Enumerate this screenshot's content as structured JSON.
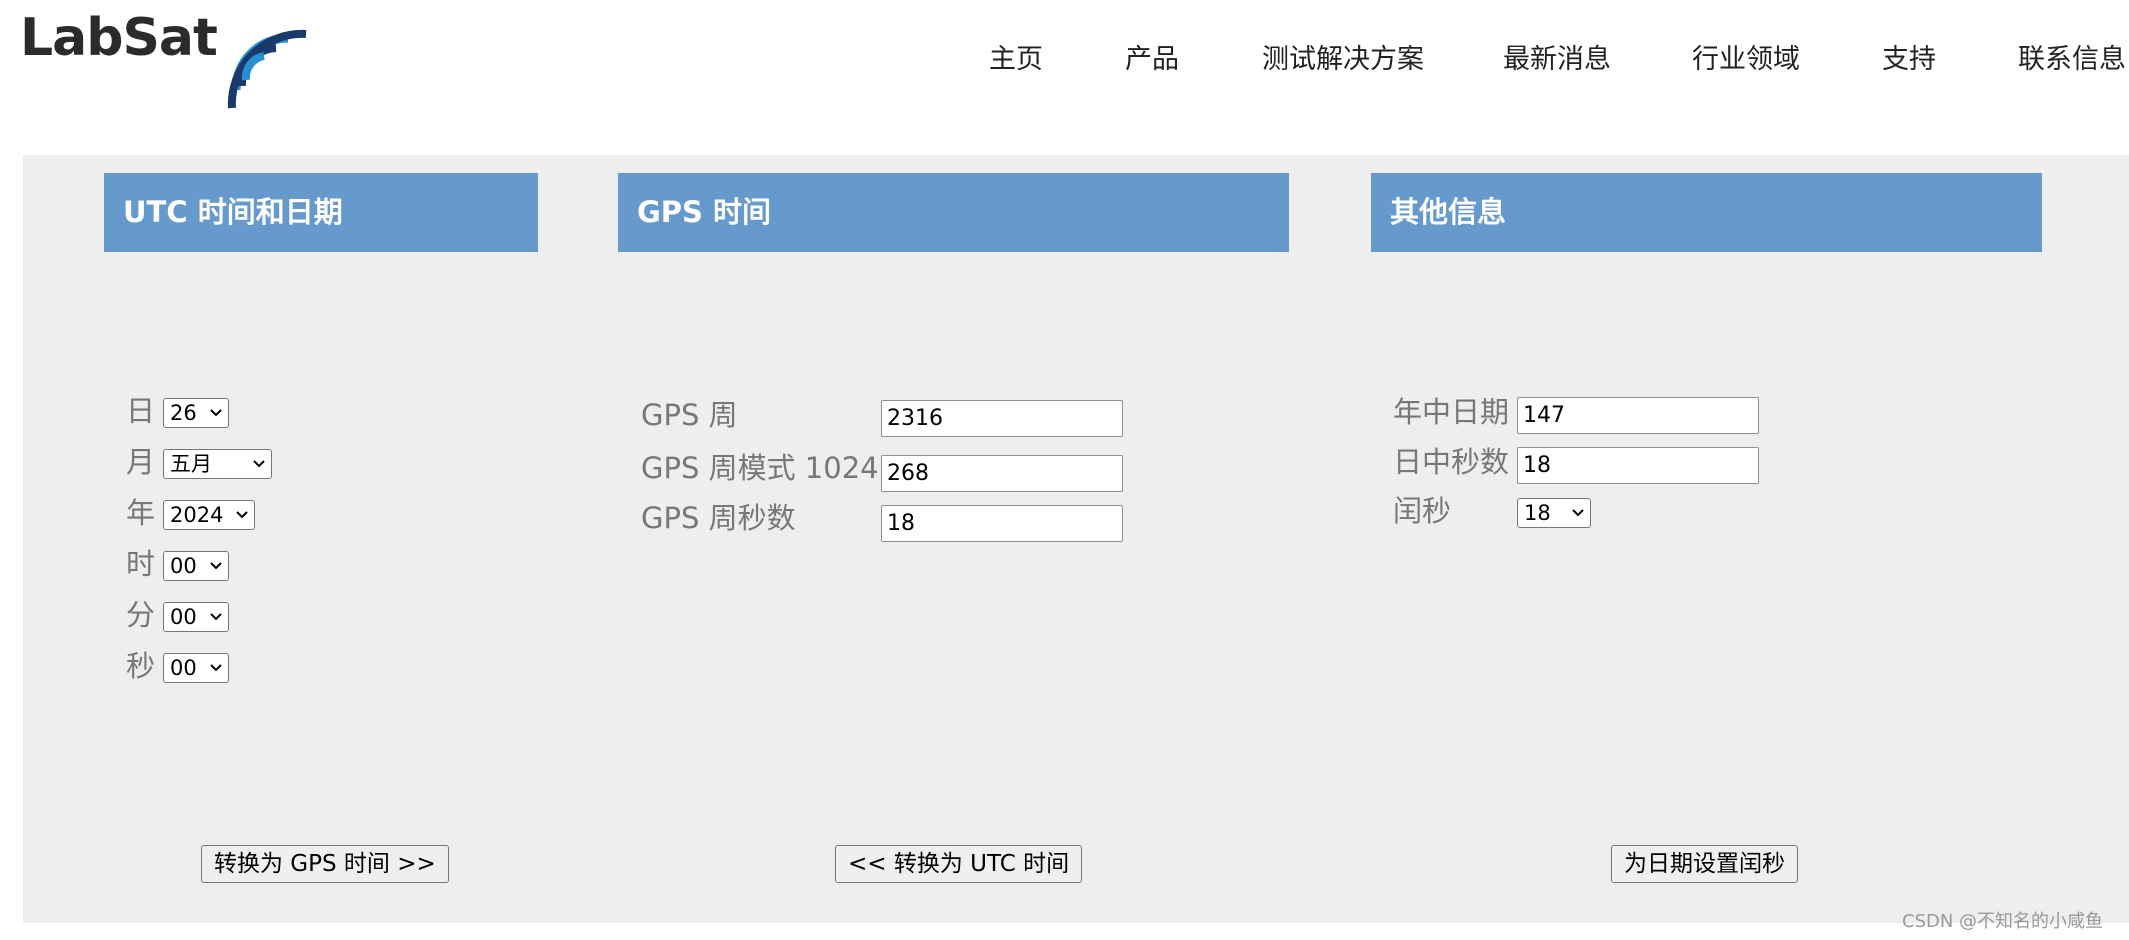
{
  "brand": {
    "logo_text": "LabSat",
    "colors": {
      "wave_blue": "#2a8fd0",
      "wave_dark": "#1a3a6b",
      "text": "#2b2b2b"
    }
  },
  "nav": {
    "items": [
      {
        "label": "主页"
      },
      {
        "label": "产品"
      },
      {
        "label": "测试解决方案"
      },
      {
        "label": "最新消息"
      },
      {
        "label": "行业领域"
      },
      {
        "label": "支持"
      },
      {
        "label": "联系信息"
      }
    ]
  },
  "theme": {
    "panel_bg": "#eeeeee",
    "header_bg": "#6699cc"
  },
  "utc": {
    "title": "UTC 时间和日期",
    "fields": {
      "day": {
        "label": "日",
        "value": "26"
      },
      "month": {
        "label": "月",
        "value": "五月"
      },
      "year": {
        "label": "年",
        "value": "2024"
      },
      "hour": {
        "label": "时",
        "value": "00"
      },
      "minute": {
        "label": "分",
        "value": "00"
      },
      "second": {
        "label": "秒",
        "value": "00"
      }
    },
    "button": "转换为 GPS 时间 >>"
  },
  "gps": {
    "title": "GPS 时间",
    "fields": {
      "week": {
        "label": "GPS 周",
        "value": "2316"
      },
      "week_mod": {
        "label": "GPS 周模式 1024",
        "value": "268"
      },
      "week_seconds": {
        "label": "GPS 周秒数",
        "value": "18"
      }
    },
    "button": "<< 转换为 UTC 时间"
  },
  "other": {
    "title": "其他信息",
    "fields": {
      "day_of_year": {
        "label": "年中日期",
        "value": "147"
      },
      "seconds_of_day": {
        "label": "日中秒数",
        "value": "18"
      },
      "leap_seconds": {
        "label": "闰秒",
        "value": "18"
      }
    },
    "button": "为日期设置闰秒"
  },
  "watermark": "CSDN @不知名的小咸鱼"
}
